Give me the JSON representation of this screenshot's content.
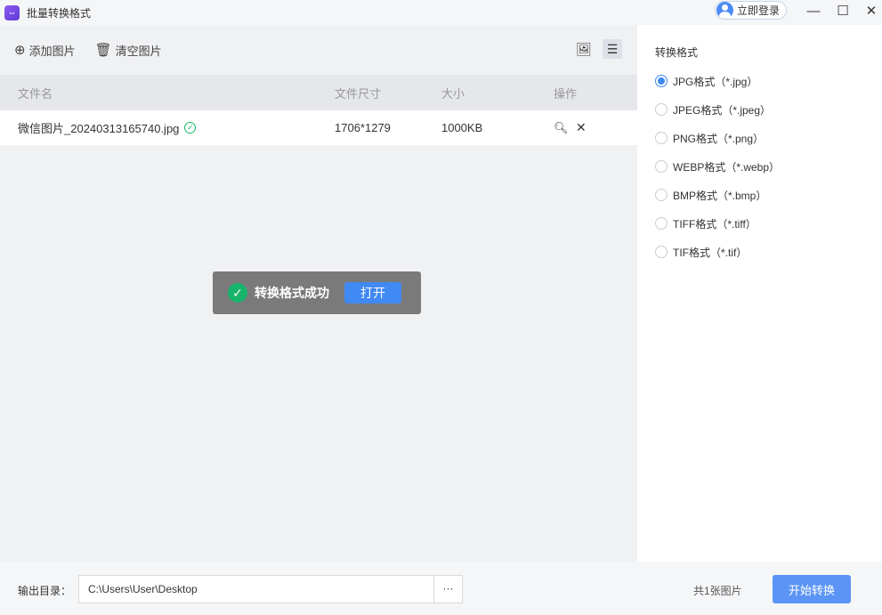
{
  "window": {
    "title": "批量转换格式",
    "login": "立即登录",
    "min": "—",
    "max": "☐",
    "close": "✕"
  },
  "toolbar": {
    "add": "添加图片",
    "clear": "清空图片"
  },
  "table": {
    "headers": [
      "文件名",
      "文件尺寸",
      "大小",
      "操作"
    ],
    "rows": [
      {
        "name": "微信图片_20240313165740.jpg",
        "dims": "1706*1279",
        "size": "1000KB"
      }
    ]
  },
  "toast": {
    "message": "转换格式成功",
    "open": "打开"
  },
  "side": {
    "title": "转换格式",
    "options": [
      "JPG格式（*.jpg）",
      "JPEG格式（*.jpeg）",
      "PNG格式（*.png）",
      "WEBP格式（*.webp）",
      "BMP格式（*.bmp）",
      "TIFF格式（*.tiff）",
      "TIF格式（*.tif）"
    ],
    "selected": 0
  },
  "footer": {
    "label": "输出目录：",
    "path": "C:\\Users\\User\\Desktop",
    "browse": "···",
    "count": "共1张图片",
    "start": "开始转换"
  },
  "colors": {
    "accent": "#4189f3",
    "success": "#18b46b"
  }
}
